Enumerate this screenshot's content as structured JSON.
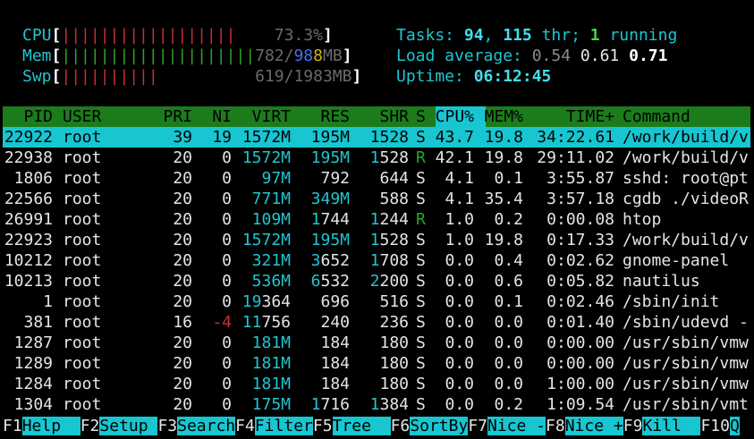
{
  "meters": {
    "cpu": {
      "label": "CPU",
      "bars": "||||||||||||||||||",
      "value": "73.3%"
    },
    "mem": {
      "label": "Mem",
      "bars": "||||||||||||||||||||",
      "used": "782",
      "sep": "/",
      "buf": "98",
      "cache": "8",
      "unit": "MB"
    },
    "swp": {
      "label": "Swp",
      "bars": "||||||||||",
      "value": "619/1983MB"
    }
  },
  "summary": {
    "tasks_label": "Tasks: ",
    "tasks": "94",
    "thr_sep": ", ",
    "thr": "115",
    "thr_label": " thr; ",
    "running": "1",
    "running_label": " running",
    "load_label": "Load average: ",
    "load1": "0.54",
    "load5": "0.61",
    "load15": "0.71",
    "uptime_label": "Uptime: ",
    "uptime": "06:12:45"
  },
  "columns": [
    "PID",
    "USER",
    "PRI",
    "NI",
    "VIRT",
    "RES",
    "SHR",
    "S",
    "CPU%",
    "MEM%",
    "TIME+",
    "Command"
  ],
  "processes": [
    {
      "pid": "22922",
      "user": "root",
      "pri": "39",
      "ni": "19",
      "virt": "1572M",
      "res": "195M",
      "shr": "1528",
      "s": "S",
      "cpu": "43.7",
      "mem": "19.8",
      "time": "34:22.61",
      "cmd": "/work/build/v"
    },
    {
      "pid": "22938",
      "user": "root",
      "pri": "20",
      "ni": "0",
      "virt": "1572M",
      "res": "195M",
      "shr": "1528",
      "s": "R",
      "cpu": "42.1",
      "mem": "19.8",
      "time": "29:11.02",
      "cmd": "/work/build/v"
    },
    {
      "pid": "1806",
      "user": "root",
      "pri": "20",
      "ni": "0",
      "virt": "97M",
      "res": "792",
      "shr": "644",
      "s": "S",
      "cpu": "4.1",
      "mem": "0.1",
      "time": "3:55.87",
      "cmd": "sshd: root@pt"
    },
    {
      "pid": "22566",
      "user": "root",
      "pri": "20",
      "ni": "0",
      "virt": "771M",
      "res": "349M",
      "shr": "588",
      "s": "S",
      "cpu": "4.1",
      "mem": "35.4",
      "time": "3:57.18",
      "cmd": "cgdb ./videoR"
    },
    {
      "pid": "26991",
      "user": "root",
      "pri": "20",
      "ni": "0",
      "virt": "109M",
      "res": "1744",
      "shr": "1244",
      "s": "R",
      "cpu": "1.0",
      "mem": "0.2",
      "time": "0:00.08",
      "cmd": "htop"
    },
    {
      "pid": "22923",
      "user": "root",
      "pri": "20",
      "ni": "0",
      "virt": "1572M",
      "res": "195M",
      "shr": "1528",
      "s": "S",
      "cpu": "1.0",
      "mem": "19.8",
      "time": "0:17.33",
      "cmd": "/work/build/v"
    },
    {
      "pid": "10212",
      "user": "root",
      "pri": "20",
      "ni": "0",
      "virt": "321M",
      "res": "3652",
      "shr": "1708",
      "s": "S",
      "cpu": "0.0",
      "mem": "0.4",
      "time": "0:02.62",
      "cmd": "gnome-panel"
    },
    {
      "pid": "10213",
      "user": "root",
      "pri": "20",
      "ni": "0",
      "virt": "536M",
      "res": "6532",
      "shr": "2200",
      "s": "S",
      "cpu": "0.0",
      "mem": "0.6",
      "time": "0:05.82",
      "cmd": "nautilus"
    },
    {
      "pid": "1",
      "user": "root",
      "pri": "20",
      "ni": "0",
      "virt": "19364",
      "res": "696",
      "shr": "516",
      "s": "S",
      "cpu": "0.0",
      "mem": "0.1",
      "time": "0:02.46",
      "cmd": "/sbin/init"
    },
    {
      "pid": "381",
      "user": "root",
      "pri": "16",
      "ni": "-4",
      "virt": "11756",
      "res": "240",
      "shr": "236",
      "s": "S",
      "cpu": "0.0",
      "mem": "0.0",
      "time": "0:01.40",
      "cmd": "/sbin/udevd -"
    },
    {
      "pid": "1287",
      "user": "root",
      "pri": "20",
      "ni": "0",
      "virt": "181M",
      "res": "184",
      "shr": "180",
      "s": "S",
      "cpu": "0.0",
      "mem": "0.0",
      "time": "0:00.00",
      "cmd": "/usr/sbin/vmw"
    },
    {
      "pid": "1289",
      "user": "root",
      "pri": "20",
      "ni": "0",
      "virt": "181M",
      "res": "184",
      "shr": "180",
      "s": "S",
      "cpu": "0.0",
      "mem": "0.0",
      "time": "0:00.00",
      "cmd": "/usr/sbin/vmw"
    },
    {
      "pid": "1284",
      "user": "root",
      "pri": "20",
      "ni": "0",
      "virt": "181M",
      "res": "184",
      "shr": "180",
      "s": "S",
      "cpu": "0.0",
      "mem": "0.0",
      "time": "1:00.00",
      "cmd": "/usr/sbin/vmw"
    },
    {
      "pid": "1304",
      "user": "root",
      "pri": "20",
      "ni": "0",
      "virt": "175M",
      "res": "1716",
      "shr": "1384",
      "s": "S",
      "cpu": "0.0",
      "mem": "0.2",
      "time": "1:09.54",
      "cmd": "/usr/sbin/vmt"
    }
  ],
  "footer": [
    {
      "key": "F1",
      "label": "Help  "
    },
    {
      "key": "F2",
      "label": "Setup "
    },
    {
      "key": "F3",
      "label": "Search"
    },
    {
      "key": "F4",
      "label": "Filter"
    },
    {
      "key": "F5",
      "label": "Tree  "
    },
    {
      "key": "F6",
      "label": "SortBy"
    },
    {
      "key": "F7",
      "label": "Nice -"
    },
    {
      "key": "F8",
      "label": "Nice +"
    },
    {
      "key": "F9",
      "label": "Kill  "
    },
    {
      "key": "F10",
      "label": "Q"
    }
  ],
  "colors": {
    "cyan": "#17c6d1",
    "green": "#1c7c1c",
    "red": "#c83030"
  }
}
